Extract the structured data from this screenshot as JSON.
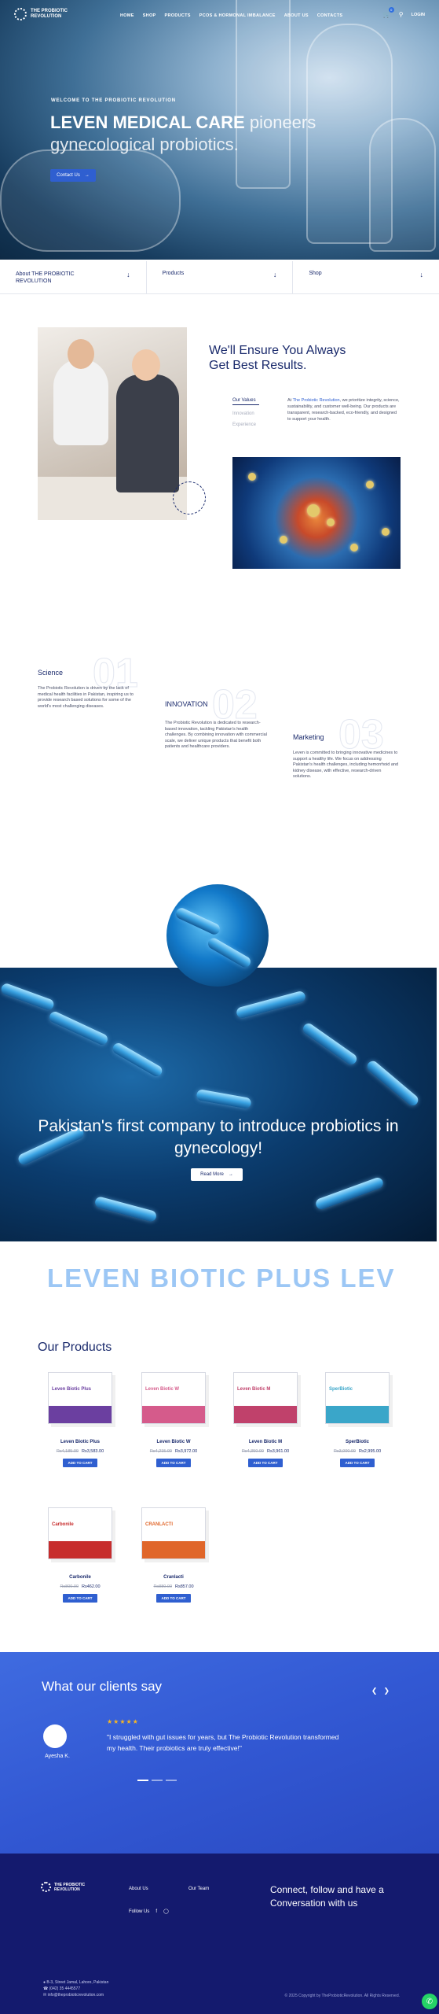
{
  "brand": {
    "name_line1": "THE PROBIOTIC",
    "name_line2": "REVOLUTION"
  },
  "nav": {
    "items": [
      "HOME",
      "SHOP",
      "PRODUCTS",
      "PCOS & HORMONAL IMBALANCE",
      "ABOUT US",
      "CONTACTS"
    ],
    "cart_count": "0",
    "login_label": "LOGIN"
  },
  "hero": {
    "kicker": "WELCOME TO THE PROBIOTIC REVOLUTION",
    "title_bold": "LEVEN MEDICAL CARE",
    "title_rest": " pioneers gynecological probiotics.",
    "button_label": "Contact Us"
  },
  "accordion": [
    "About THE PROBIOTIC REVOLUTION",
    "Products",
    "Shop"
  ],
  "values": {
    "title": "We'll Ensure You Always Get Best Results.",
    "tabs": [
      "Our Values",
      "Innovation",
      "Experience"
    ],
    "text_prefix": "At ",
    "text_highlight": "The Probiotic Revolution",
    "text_rest": ", we prioritize integrity, science, sustainability, and customer well-being. Our products are transparent, research-backed, eco-friendly, and designed to support your health."
  },
  "steps": [
    {
      "num": "01",
      "title": "Science",
      "text": "The Probiotic Revolution is driven by the lack of medical health facilities in Pakistan, inspiring us to provide research based solutions for some of the world's most challenging diseases."
    },
    {
      "num": "02",
      "title": "INNOVATION",
      "text": "The Probiotic Revolution is dedicated to research-based innovation, tackling Pakistan's health challenges. By combining innovation with commercial scale, we deliver unique products that benefit both patients and healthcare providers."
    },
    {
      "num": "03",
      "title": "Marketing",
      "text": "Leven is committed to bringing innovative medicines to support a healthy life. We focus on addressing Pakistan's health challenges, including hemorrhoid and kidney disease, with effective, research-driven solutions."
    }
  ],
  "banner": {
    "title": "Pakistan's first company to introduce probiotics in gynecology!",
    "button_label": "Read More"
  },
  "marquee": "LEVEN BIOTIC PLUS   LEV",
  "products": {
    "title": "Our Products",
    "cart_label": "ADD TO CART",
    "items": [
      {
        "name": "Leven Biotic Plus",
        "old": "Rs4,185.00",
        "price": "Rs3,583.00",
        "color": "#6b3fa0",
        "box": "Leven Biotic Plus"
      },
      {
        "name": "Leven Biotic W",
        "old": "Rs4,215.00",
        "price": "Rs3,972.00",
        "color": "#d55b8b",
        "box": "Leven Biotic W"
      },
      {
        "name": "Leven Biotic M",
        "old": "Rs4,350.00",
        "price": "Rs3,961.00",
        "color": "#c0416b",
        "box": "Leven Biotic M"
      },
      {
        "name": "SperBiotic",
        "old": "Rs3,000.00",
        "price": "Rs2,995.00",
        "color": "#3aa6c9",
        "box": "SperBiotic"
      },
      {
        "name": "Carbonile",
        "old": "Rs800.00",
        "price": "Rs462.00",
        "color": "#c72d2d",
        "box": "Carbonile"
      },
      {
        "name": "Cranlacti",
        "old": "Rs880.00",
        "price": "Rs857.00",
        "color": "#e0662a",
        "box": "CRANLACTI"
      }
    ]
  },
  "testimonials": {
    "title": "What our clients say",
    "stars": "★★★★★",
    "quote": "\"I struggled with gut issues for years, but The Probiotic Revolution transformed my health. Their probiotics are truly effective!\"",
    "author": "Ayesha K."
  },
  "footer": {
    "links": [
      "About Us",
      "Our Team"
    ],
    "follow_label": "Follow Us",
    "cta": "Connect, follow and have a Conversation with us",
    "address": "B-3, Street Jamal, Lahore, Pakistan",
    "phone": "(042) 35 4445577",
    "email": "info@theprobioticrevolution.com",
    "copyright": "© 2025 Copyright by TheProbioticRevolution. All Rights Reserved."
  }
}
